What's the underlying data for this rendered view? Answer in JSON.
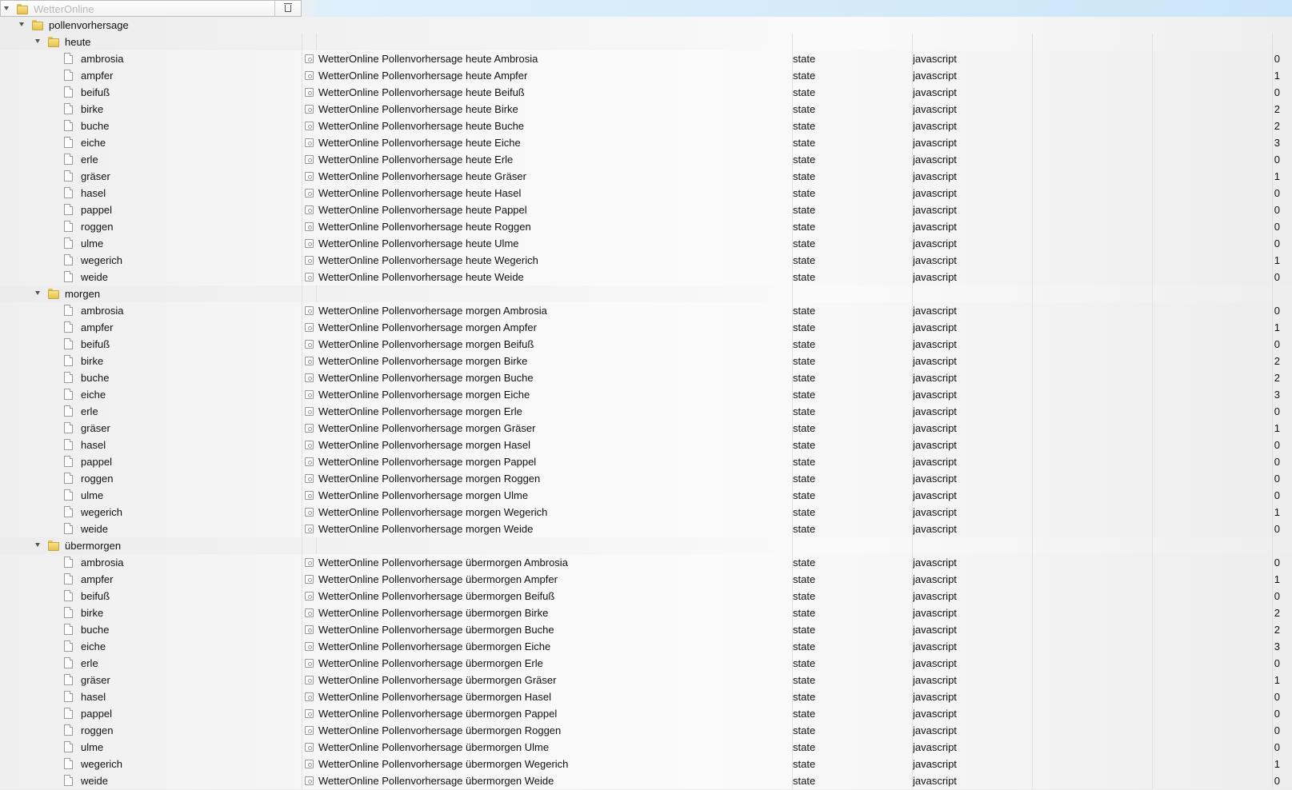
{
  "root": {
    "label": "WetterOnline"
  },
  "folder": {
    "label": "pollenvorhersage"
  },
  "groups": [
    {
      "label": "heute",
      "items": [
        {
          "name": "ambrosia",
          "title": "WetterOnline Pollenvorhersage heute Ambrosia",
          "role": "state",
          "type": "javascript",
          "value": "0"
        },
        {
          "name": "ampfer",
          "title": "WetterOnline Pollenvorhersage heute Ampfer",
          "role": "state",
          "type": "javascript",
          "value": "1"
        },
        {
          "name": "beifuß",
          "title": "WetterOnline Pollenvorhersage heute Beifuß",
          "role": "state",
          "type": "javascript",
          "value": "0"
        },
        {
          "name": "birke",
          "title": "WetterOnline Pollenvorhersage heute Birke",
          "role": "state",
          "type": "javascript",
          "value": "2"
        },
        {
          "name": "buche",
          "title": "WetterOnline Pollenvorhersage heute Buche",
          "role": "state",
          "type": "javascript",
          "value": "2"
        },
        {
          "name": "eiche",
          "title": "WetterOnline Pollenvorhersage heute Eiche",
          "role": "state",
          "type": "javascript",
          "value": "3"
        },
        {
          "name": "erle",
          "title": "WetterOnline Pollenvorhersage heute Erle",
          "role": "state",
          "type": "javascript",
          "value": "0"
        },
        {
          "name": "gräser",
          "title": "WetterOnline Pollenvorhersage heute Gräser",
          "role": "state",
          "type": "javascript",
          "value": "1"
        },
        {
          "name": "hasel",
          "title": "WetterOnline Pollenvorhersage heute Hasel",
          "role": "state",
          "type": "javascript",
          "value": "0"
        },
        {
          "name": "pappel",
          "title": "WetterOnline Pollenvorhersage heute Pappel",
          "role": "state",
          "type": "javascript",
          "value": "0"
        },
        {
          "name": "roggen",
          "title": "WetterOnline Pollenvorhersage heute Roggen",
          "role": "state",
          "type": "javascript",
          "value": "0"
        },
        {
          "name": "ulme",
          "title": "WetterOnline Pollenvorhersage heute Ulme",
          "role": "state",
          "type": "javascript",
          "value": "0"
        },
        {
          "name": "wegerich",
          "title": "WetterOnline Pollenvorhersage heute Wegerich",
          "role": "state",
          "type": "javascript",
          "value": "1"
        },
        {
          "name": "weide",
          "title": "WetterOnline Pollenvorhersage heute Weide",
          "role": "state",
          "type": "javascript",
          "value": "0"
        }
      ]
    },
    {
      "label": "morgen",
      "items": [
        {
          "name": "ambrosia",
          "title": "WetterOnline Pollenvorhersage morgen Ambrosia",
          "role": "state",
          "type": "javascript",
          "value": "0"
        },
        {
          "name": "ampfer",
          "title": "WetterOnline Pollenvorhersage morgen Ampfer",
          "role": "state",
          "type": "javascript",
          "value": "1"
        },
        {
          "name": "beifuß",
          "title": "WetterOnline Pollenvorhersage morgen Beifuß",
          "role": "state",
          "type": "javascript",
          "value": "0"
        },
        {
          "name": "birke",
          "title": "WetterOnline Pollenvorhersage morgen Birke",
          "role": "state",
          "type": "javascript",
          "value": "2"
        },
        {
          "name": "buche",
          "title": "WetterOnline Pollenvorhersage morgen Buche",
          "role": "state",
          "type": "javascript",
          "value": "2"
        },
        {
          "name": "eiche",
          "title": "WetterOnline Pollenvorhersage morgen Eiche",
          "role": "state",
          "type": "javascript",
          "value": "3"
        },
        {
          "name": "erle",
          "title": "WetterOnline Pollenvorhersage morgen Erle",
          "role": "state",
          "type": "javascript",
          "value": "0"
        },
        {
          "name": "gräser",
          "title": "WetterOnline Pollenvorhersage morgen Gräser",
          "role": "state",
          "type": "javascript",
          "value": "1"
        },
        {
          "name": "hasel",
          "title": "WetterOnline Pollenvorhersage morgen Hasel",
          "role": "state",
          "type": "javascript",
          "value": "0"
        },
        {
          "name": "pappel",
          "title": "WetterOnline Pollenvorhersage morgen Pappel",
          "role": "state",
          "type": "javascript",
          "value": "0"
        },
        {
          "name": "roggen",
          "title": "WetterOnline Pollenvorhersage morgen Roggen",
          "role": "state",
          "type": "javascript",
          "value": "0"
        },
        {
          "name": "ulme",
          "title": "WetterOnline Pollenvorhersage morgen Ulme",
          "role": "state",
          "type": "javascript",
          "value": "0"
        },
        {
          "name": "wegerich",
          "title": "WetterOnline Pollenvorhersage morgen Wegerich",
          "role": "state",
          "type": "javascript",
          "value": "1"
        },
        {
          "name": "weide",
          "title": "WetterOnline Pollenvorhersage morgen Weide",
          "role": "state",
          "type": "javascript",
          "value": "0"
        }
      ]
    },
    {
      "label": "übermorgen",
      "items": [
        {
          "name": "ambrosia",
          "title": "WetterOnline Pollenvorhersage übermorgen Ambrosia",
          "role": "state",
          "type": "javascript",
          "value": "0"
        },
        {
          "name": "ampfer",
          "title": "WetterOnline Pollenvorhersage übermorgen Ampfer",
          "role": "state",
          "type": "javascript",
          "value": "1"
        },
        {
          "name": "beifuß",
          "title": "WetterOnline Pollenvorhersage übermorgen Beifuß",
          "role": "state",
          "type": "javascript",
          "value": "0"
        },
        {
          "name": "birke",
          "title": "WetterOnline Pollenvorhersage übermorgen Birke",
          "role": "state",
          "type": "javascript",
          "value": "2"
        },
        {
          "name": "buche",
          "title": "WetterOnline Pollenvorhersage übermorgen Buche",
          "role": "state",
          "type": "javascript",
          "value": "2"
        },
        {
          "name": "eiche",
          "title": "WetterOnline Pollenvorhersage übermorgen Eiche",
          "role": "state",
          "type": "javascript",
          "value": "3"
        },
        {
          "name": "erle",
          "title": "WetterOnline Pollenvorhersage übermorgen Erle",
          "role": "state",
          "type": "javascript",
          "value": "0"
        },
        {
          "name": "gräser",
          "title": "WetterOnline Pollenvorhersage übermorgen Gräser",
          "role": "state",
          "type": "javascript",
          "value": "1"
        },
        {
          "name": "hasel",
          "title": "WetterOnline Pollenvorhersage übermorgen Hasel",
          "role": "state",
          "type": "javascript",
          "value": "0"
        },
        {
          "name": "pappel",
          "title": "WetterOnline Pollenvorhersage übermorgen Pappel",
          "role": "state",
          "type": "javascript",
          "value": "0"
        },
        {
          "name": "roggen",
          "title": "WetterOnline Pollenvorhersage übermorgen Roggen",
          "role": "state",
          "type": "javascript",
          "value": "0"
        },
        {
          "name": "ulme",
          "title": "WetterOnline Pollenvorhersage übermorgen Ulme",
          "role": "state",
          "type": "javascript",
          "value": "0"
        },
        {
          "name": "wegerich",
          "title": "WetterOnline Pollenvorhersage übermorgen Wegerich",
          "role": "state",
          "type": "javascript",
          "value": "1"
        },
        {
          "name": "weide",
          "title": "WetterOnline Pollenvorhersage übermorgen Weide",
          "role": "state",
          "type": "javascript",
          "value": "0"
        }
      ]
    }
  ]
}
